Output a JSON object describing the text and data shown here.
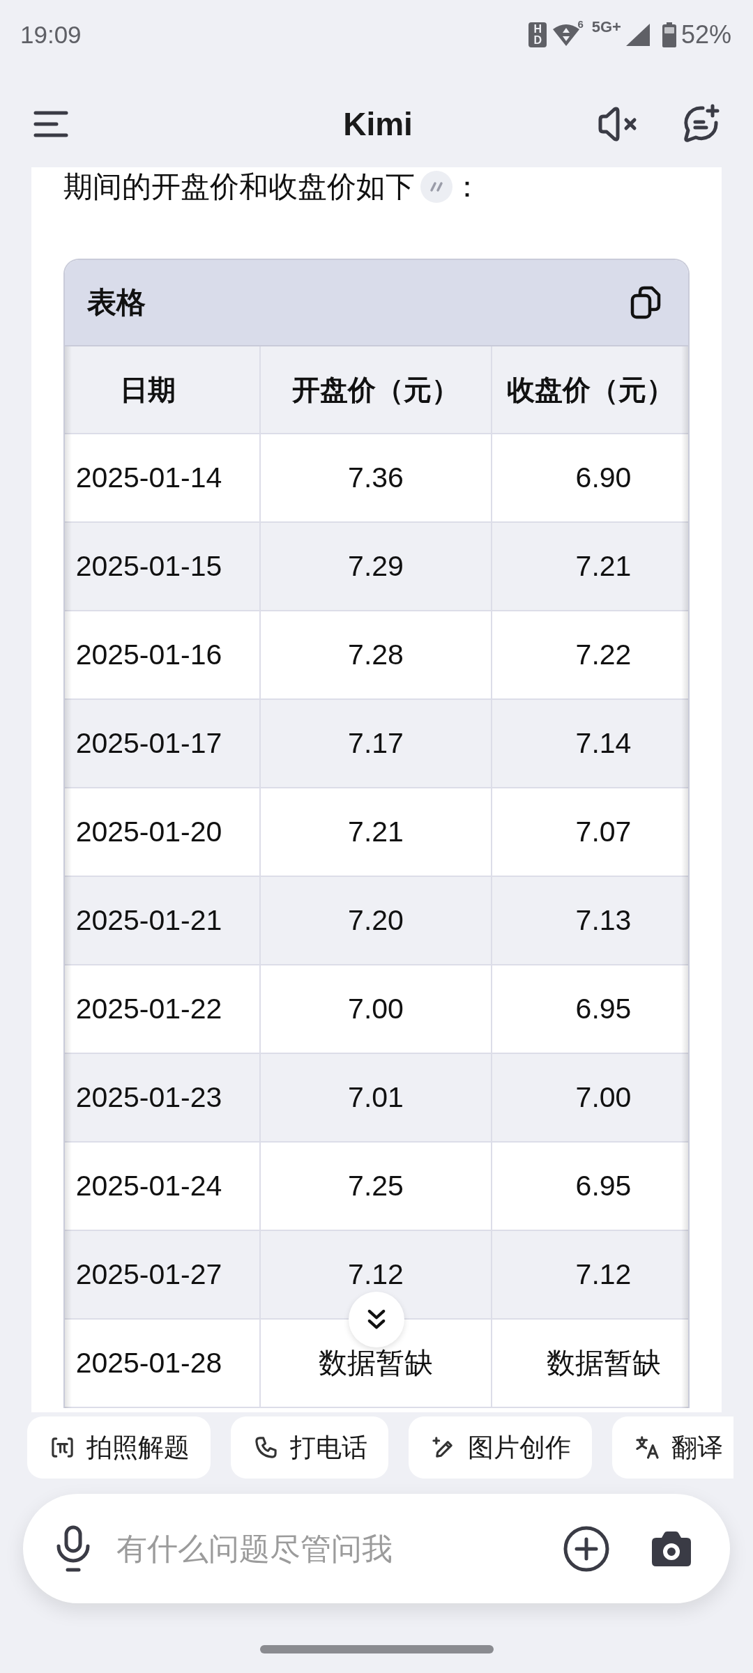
{
  "status_bar": {
    "time": "19:09",
    "hd_badge": "HD",
    "wifi_generation": "6",
    "network": "5G+",
    "battery": "52%"
  },
  "header": {
    "title": "Kimi"
  },
  "message": {
    "intro": "期间的开盘价和收盘价如下",
    "intro_end": "："
  },
  "table": {
    "title": "表格",
    "columns": [
      "日期",
      "开盘价（元）",
      "收盘价（元）"
    ],
    "rows": [
      [
        "2025-01-14",
        "7.36",
        "6.90"
      ],
      [
        "2025-01-15",
        "7.29",
        "7.21"
      ],
      [
        "2025-01-16",
        "7.28",
        "7.22"
      ],
      [
        "2025-01-17",
        "7.17",
        "7.14"
      ],
      [
        "2025-01-20",
        "7.21",
        "7.07"
      ],
      [
        "2025-01-21",
        "7.20",
        "7.13"
      ],
      [
        "2025-01-22",
        "7.00",
        "6.95"
      ],
      [
        "2025-01-23",
        "7.01",
        "7.00"
      ],
      [
        "2025-01-24",
        "7.25",
        "6.95"
      ],
      [
        "2025-01-27",
        "7.12",
        "7.12"
      ],
      [
        "2025-01-28",
        "数据暂缺",
        "数据暂缺"
      ]
    ]
  },
  "quick_actions": [
    "拍照解题",
    "打电话",
    "图片创作",
    "翻译"
  ],
  "input": {
    "placeholder": "有什么问题尽管问我"
  }
}
